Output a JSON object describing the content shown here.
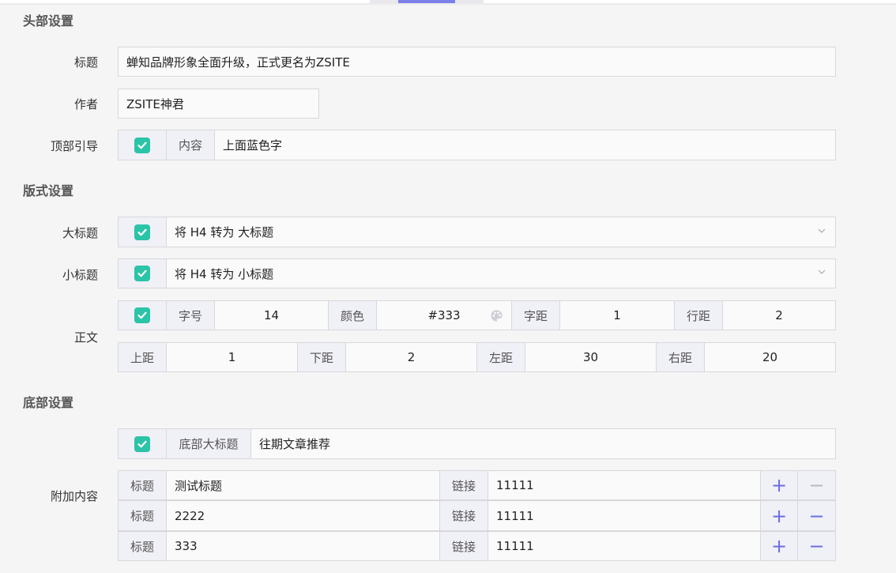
{
  "sections": {
    "header": "头部设置",
    "format": "版式设置",
    "footer": "底部设置"
  },
  "header": {
    "title_label": "标题",
    "title_value": "蝉知品牌形象全面升级，正式更名为ZSITE",
    "author_label": "作者",
    "author_value": "ZSITE神君",
    "guide_label": "顶部引导",
    "guide_content_label": "内容",
    "guide_content_value": "上面蓝色字",
    "guide_checked": true
  },
  "format": {
    "big_title_label": "大标题",
    "big_title_value": "将 H4 转为 大标题",
    "small_title_label": "小标题",
    "small_title_value": "将 H4 转为 小标题",
    "body_label": "正文",
    "font_size_label": "字号",
    "font_size_value": "14",
    "color_label": "颜色",
    "color_value": "#333",
    "letter_spacing_label": "字距",
    "letter_spacing_value": "1",
    "line_spacing_label": "行距",
    "line_spacing_value": "2",
    "margin_top_label": "上距",
    "margin_top_value": "1",
    "margin_bottom_label": "下距",
    "margin_bottom_value": "2",
    "margin_left_label": "左距",
    "margin_left_value": "30",
    "margin_right_label": "右距",
    "margin_right_value": "20"
  },
  "footer": {
    "footer_title_label": "底部大标题",
    "footer_title_value": "往期文章推荐",
    "extra_label": "附加内容",
    "rows": [
      {
        "title_label": "标题",
        "title_value": "测试标题",
        "link_label": "链接",
        "link_value": "11111"
      },
      {
        "title_label": "标题",
        "title_value": "2222",
        "link_label": "链接",
        "link_value": "11111"
      },
      {
        "title_label": "标题",
        "title_value": "333",
        "link_label": "链接",
        "link_value": "11111"
      }
    ]
  },
  "icons": {
    "checkbox": "check-icon",
    "dropdown": "chevron-down-icon",
    "color": "palette-icon",
    "add": "plus-icon",
    "remove": "minus-icon"
  },
  "colors": {
    "accent": "#6a6ee0",
    "check": "#2bc4a8"
  }
}
